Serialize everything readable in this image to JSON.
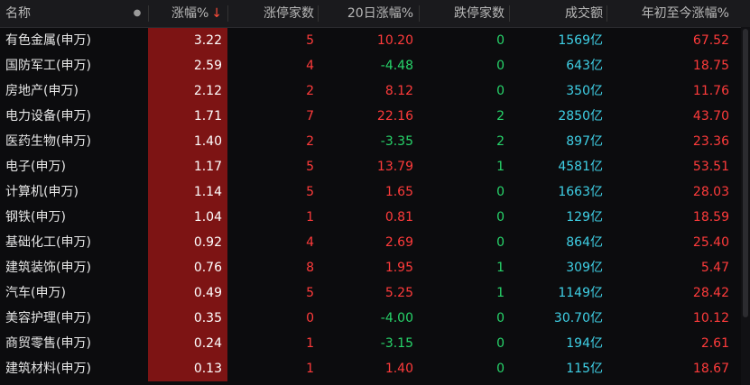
{
  "header": {
    "name": "名称",
    "dot": "●",
    "change": "涨幅%",
    "sort_arrow": "↓",
    "limit_up": "涨停家数",
    "change_20d": "20日涨幅%",
    "limit_down": "跌停家数",
    "volume": "成交额",
    "ytd": "年初至今涨幅%"
  },
  "rows": [
    {
      "name": "有色金属(申万)",
      "change": "3.22",
      "limit_up": "5",
      "change_20d": "10.20",
      "limit_down": "0",
      "volume": "1569亿",
      "ytd": "67.52"
    },
    {
      "name": "国防军工(申万)",
      "change": "2.59",
      "limit_up": "4",
      "change_20d": "-4.48",
      "limit_down": "0",
      "volume": "643亿",
      "ytd": "18.75"
    },
    {
      "name": "房地产(申万)",
      "change": "2.12",
      "limit_up": "2",
      "change_20d": "8.12",
      "limit_down": "0",
      "volume": "350亿",
      "ytd": "11.76"
    },
    {
      "name": "电力设备(申万)",
      "change": "1.71",
      "limit_up": "7",
      "change_20d": "22.16",
      "limit_down": "2",
      "volume": "2850亿",
      "ytd": "43.70"
    },
    {
      "name": "医药生物(申万)",
      "change": "1.40",
      "limit_up": "2",
      "change_20d": "-3.35",
      "limit_down": "2",
      "volume": "897亿",
      "ytd": "23.36"
    },
    {
      "name": "电子(申万)",
      "change": "1.17",
      "limit_up": "5",
      "change_20d": "13.79",
      "limit_down": "1",
      "volume": "4581亿",
      "ytd": "53.51"
    },
    {
      "name": "计算机(申万)",
      "change": "1.14",
      "limit_up": "5",
      "change_20d": "1.65",
      "limit_down": "0",
      "volume": "1663亿",
      "ytd": "28.03"
    },
    {
      "name": "钢铁(申万)",
      "change": "1.04",
      "limit_up": "1",
      "change_20d": "0.81",
      "limit_down": "0",
      "volume": "129亿",
      "ytd": "18.59"
    },
    {
      "name": "基础化工(申万)",
      "change": "0.92",
      "limit_up": "4",
      "change_20d": "2.69",
      "limit_down": "0",
      "volume": "864亿",
      "ytd": "25.40"
    },
    {
      "name": "建筑装饰(申万)",
      "change": "0.76",
      "limit_up": "8",
      "change_20d": "1.95",
      "limit_down": "1",
      "volume": "309亿",
      "ytd": "5.47"
    },
    {
      "name": "汽车(申万)",
      "change": "0.49",
      "limit_up": "5",
      "change_20d": "5.25",
      "limit_down": "1",
      "volume": "1149亿",
      "ytd": "28.42"
    },
    {
      "name": "美容护理(申万)",
      "change": "0.35",
      "limit_up": "0",
      "change_20d": "-4.00",
      "limit_down": "0",
      "volume": "30.70亿",
      "ytd": "10.12"
    },
    {
      "name": "商贸零售(申万)",
      "change": "0.24",
      "limit_up": "1",
      "change_20d": "-3.15",
      "limit_down": "0",
      "volume": "194亿",
      "ytd": "2.61"
    },
    {
      "name": "建筑材料(申万)",
      "change": "0.13",
      "limit_up": "1",
      "change_20d": "1.40",
      "limit_down": "0",
      "volume": "115亿",
      "ytd": "18.67"
    }
  ],
  "colors": {
    "up": "#ff3b3b",
    "down": "#27d46a",
    "volume": "#3fd0e6",
    "change_bg": "#7d1414"
  }
}
